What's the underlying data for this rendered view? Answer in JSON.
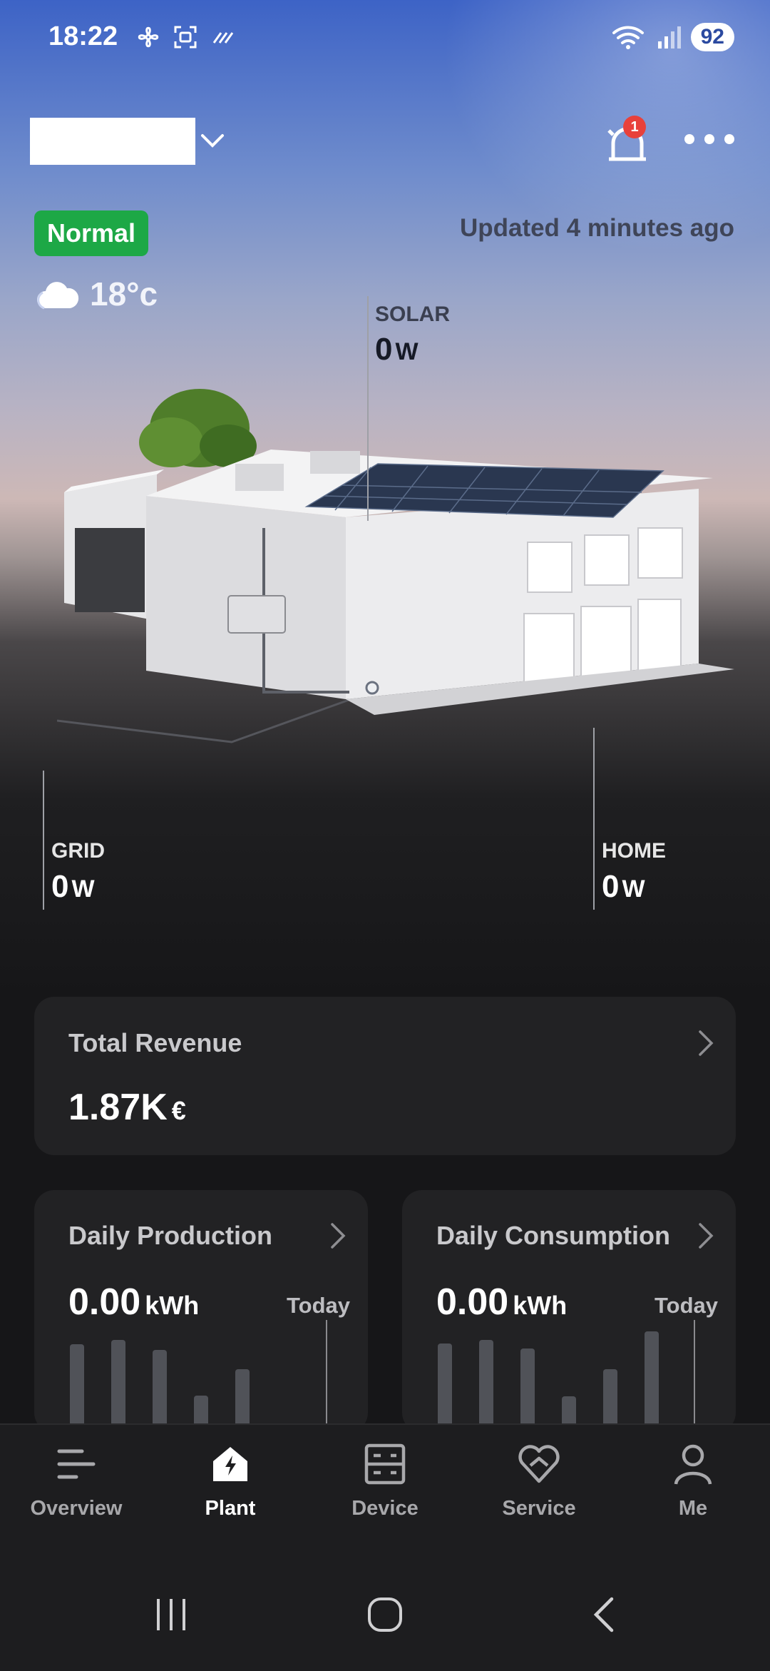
{
  "status_bar": {
    "time": "18:22",
    "battery": "92"
  },
  "header": {
    "alarm_count": "1"
  },
  "plant_status": {
    "badge": "Normal",
    "updated": "Updated 4 minutes ago",
    "temperature": "18°c"
  },
  "flows": {
    "solar": {
      "label": "SOLAR",
      "value": "0",
      "unit": "W"
    },
    "grid": {
      "label": "GRID",
      "value": "0",
      "unit": "W"
    },
    "home": {
      "label": "HOME",
      "value": "0",
      "unit": "W"
    }
  },
  "revenue": {
    "title": "Total Revenue",
    "value": "1.87K",
    "unit": "€"
  },
  "production": {
    "title": "Daily Production",
    "value": "0.00",
    "unit": "kWh",
    "period": "Today",
    "bars": [
      0.95,
      1.0,
      0.88,
      0.35,
      0.66
    ]
  },
  "consumption": {
    "title": "Daily Consumption",
    "value": "0.00",
    "unit": "kWh",
    "period": "Today",
    "bars": [
      0.96,
      1.0,
      0.9,
      0.34,
      0.66,
      1.1
    ]
  },
  "nav": {
    "overview": "Overview",
    "plant": "Plant",
    "device": "Device",
    "service": "Service",
    "me": "Me",
    "active": "plant"
  },
  "colors": {
    "normal_badge": "#1da846",
    "alarm_badge": "#e8413b",
    "card_bg": "#222224"
  }
}
